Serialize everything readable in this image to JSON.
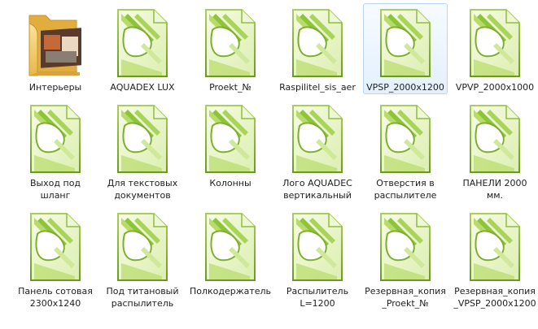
{
  "items": [
    {
      "label": "Интерьеры",
      "icon": "folder-icon",
      "selected": false
    },
    {
      "label": "AQUADEX LUX",
      "icon": "coreldraw-file-icon",
      "selected": false
    },
    {
      "label": "Proekt_№",
      "icon": "coreldraw-file-icon",
      "selected": false
    },
    {
      "label": "Raspilitel_sis_aer",
      "icon": "coreldraw-file-icon",
      "selected": false
    },
    {
      "label": "VPSP_2000x1200",
      "icon": "coreldraw-file-icon",
      "selected": true
    },
    {
      "label": "VPVP_2000x1000",
      "icon": "coreldraw-file-icon",
      "selected": false
    },
    {
      "label": "Выход под шланг",
      "icon": "coreldraw-file-icon",
      "selected": false
    },
    {
      "label": "Для текстовых документов",
      "icon": "coreldraw-file-icon",
      "selected": false
    },
    {
      "label": "Колонны",
      "icon": "coreldraw-file-icon",
      "selected": false
    },
    {
      "label": "Лого AQUADEC вертикальный",
      "icon": "coreldraw-file-icon",
      "selected": false
    },
    {
      "label": "Отверстия в распылителе",
      "icon": "coreldraw-file-icon",
      "selected": false
    },
    {
      "label": "ПАНЕЛИ 2000 мм.",
      "icon": "coreldraw-file-icon",
      "selected": false
    },
    {
      "label": "Панель сотовая 2300х1240",
      "icon": "coreldraw-file-icon",
      "selected": false
    },
    {
      "label": "Под титановый распылитель",
      "icon": "coreldraw-file-icon",
      "selected": false
    },
    {
      "label": "Полкодержатель",
      "icon": "coreldraw-file-icon",
      "selected": false
    },
    {
      "label": "Распылитель L=1200",
      "icon": "coreldraw-file-icon",
      "selected": false
    },
    {
      "label": "Резервная_копия_Proekt_№",
      "icon": "coreldraw-file-icon",
      "selected": false
    },
    {
      "label": "Резервная_копия_VPSP_2000x1200",
      "icon": "coreldraw-file-icon",
      "selected": false
    }
  ],
  "colors": {
    "icon_green_dark": "#7fae2e",
    "icon_green_light": "#e9f5c8",
    "selection_border": "#b9d7f3",
    "folder_yellow": "#f3cf6b"
  }
}
